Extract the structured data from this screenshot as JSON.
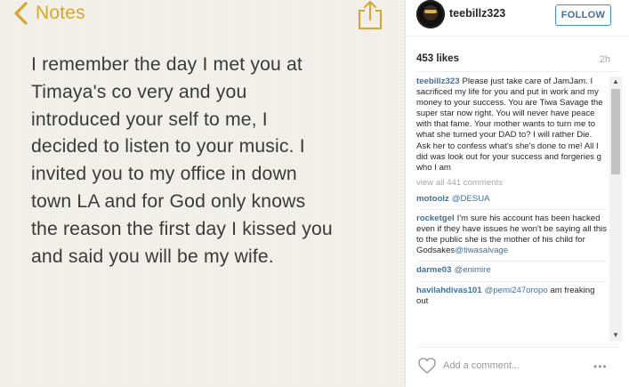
{
  "notes": {
    "back_label": "Notes",
    "lines": [
      "I remember the day I met you at",
      "Timaya's co very and you",
      "introduced your self to me, I",
      "decided to listen to your music. I",
      "invited you to my office in down",
      "town LA and for God only knows",
      "the reason the first day I kissed you",
      "and said you will be my wife."
    ],
    "accent_color": "#d6a72a",
    "icons": {
      "back": "chevron-left-icon",
      "share": "share-icon"
    }
  },
  "post": {
    "username": "teebillz323",
    "follow_label": "FOLLOW",
    "likes": "453 likes",
    "time": "2h",
    "caption": {
      "user": "teebillz323",
      "text": "Please just take care of JamJam. I sacrificed my life for you and put in work and my money to your success. You are Tiwa Savage the super star now right. You will never have peace with that fame. Your mother wants to turn me to what she turned your DAD to? I will rather Die. Ask her to confess what's she's done to me! All I did was look out for your success and forgeries g who I am"
    },
    "view_all": "view all 441 comments",
    "comments": [
      {
        "user": "motoolz",
        "text": "",
        "mention": "@DESUA"
      },
      {
        "user": "rocketgel",
        "text": "I'm sure his account has been hacked even if they have issues he won't be saying all this to the public she is the mother of his child for Godsakes",
        "mention": "@tiwasalvage"
      },
      {
        "user": "darme03",
        "text": "",
        "mention": "@enimire"
      },
      {
        "user": "havilahdivas101",
        "text": "",
        "mention": "@pemi247oropo",
        "text_after": "am freaking out"
      }
    ],
    "add_comment_placeholder": "Add a comment...",
    "more_label": "•••",
    "link_color": "#3f729b",
    "icons": {
      "like": "heart-icon",
      "more": "more-options-icon",
      "scroll_up": "scroll-up-arrow",
      "scroll_down": "scroll-down-arrow"
    }
  }
}
